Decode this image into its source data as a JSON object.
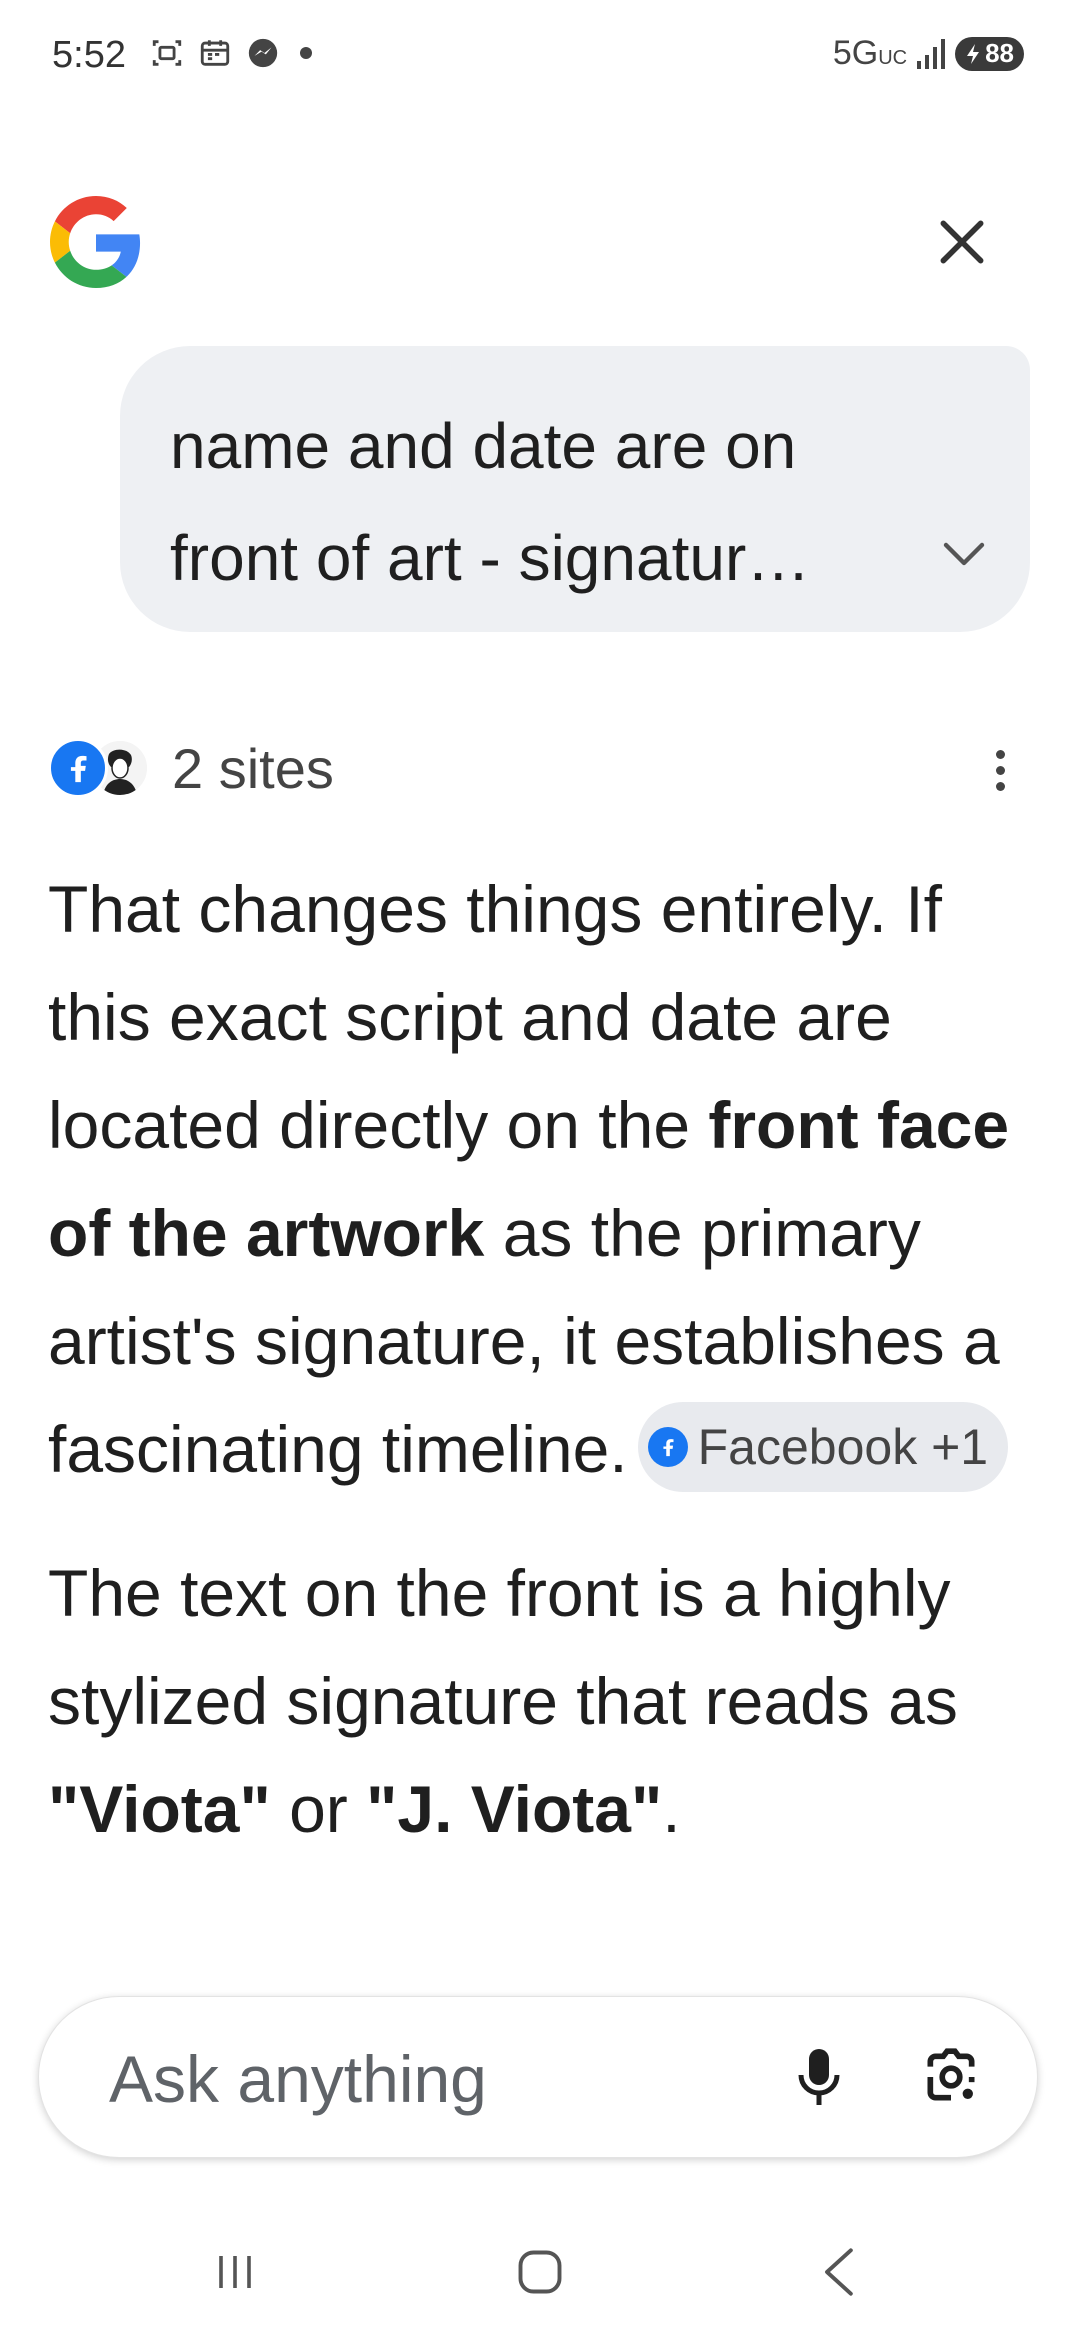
{
  "status_bar": {
    "time": "5:52",
    "network": "5G",
    "network_sub": "UC",
    "battery": "88",
    "icons": [
      "screenshot-icon",
      "calendar-icon",
      "messenger-icon",
      "notification-dot-icon",
      "signal-icon",
      "battery-icon"
    ]
  },
  "header": {
    "logo_icon": "google-g-logo",
    "close_icon": "close-icon"
  },
  "query": {
    "text": "name and date are on front of art - signatur…",
    "expand_icon": "chevron-down-icon"
  },
  "sources": {
    "label": "2 sites",
    "favicons": [
      "facebook-icon",
      "person-avatar-icon"
    ],
    "menu_icon": "more-vert-icon"
  },
  "answer": {
    "p1_a": "That changes things entirely. If this exact script and date are located directly on the ",
    "p1_bold": "front face of the artwork",
    "p1_b": " as the primary artist's signature, it establishes a fascinating timeline.",
    "citation_label": "Facebook +1",
    "p2_a": "The text on the front is a highly stylized signature that reads as ",
    "p2_bold1": "\"Viota\"",
    "p2_mid": " or ",
    "p2_bold2": "\"J. Viota\"",
    "p2_end": "."
  },
  "input": {
    "placeholder": "Ask anything",
    "mic_icon": "mic-icon",
    "lens_icon": "google-lens-icon"
  },
  "nav": {
    "icons": [
      "recent-apps-icon",
      "home-icon",
      "back-icon"
    ]
  },
  "colors": {
    "bubble_bg": "#eef0f3",
    "chip_bg": "#e8eaee",
    "facebook_blue": "#1877f2",
    "text": "#1f1f1f",
    "muted": "#5f6368"
  }
}
